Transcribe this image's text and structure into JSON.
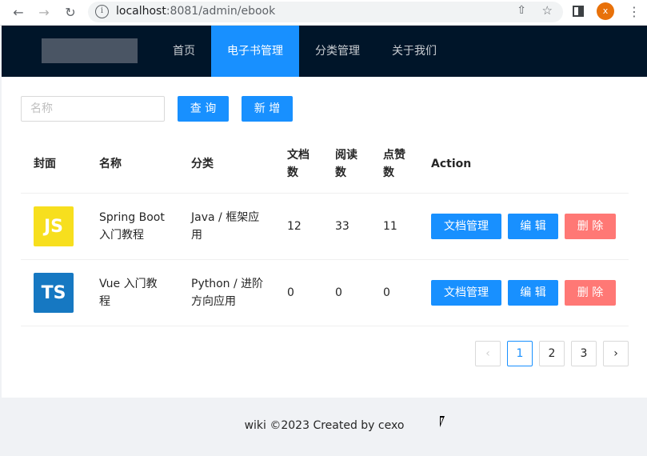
{
  "browser": {
    "url_host": "localhost",
    "url_rest": ":8081/admin/ebook",
    "profile_initial": "x"
  },
  "header": {
    "menu": [
      "首页",
      "电子书管理",
      "分类管理",
      "关于我们"
    ],
    "active_index": 1
  },
  "toolbar": {
    "search_placeholder": "名称",
    "query_label": "查 询",
    "add_label": "新 增"
  },
  "table": {
    "columns": [
      "封面",
      "名称",
      "分类",
      "文档数",
      "阅读数",
      "点赞数",
      "Action"
    ],
    "rows": [
      {
        "cover": "JS",
        "name": "Spring Boot 入门教程",
        "category": "Java / 框架应用",
        "doc_count": "12",
        "view_count": "33",
        "vote_count": "11",
        "actions": [
          "文档管理",
          "编 辑",
          "删 除"
        ]
      },
      {
        "cover": "TS",
        "name": "Vue 入门教程",
        "category": "Python / 进阶方向应用",
        "doc_count": "0",
        "view_count": "0",
        "vote_count": "0",
        "actions": [
          "文档管理",
          "编 辑",
          "删 除"
        ]
      }
    ]
  },
  "pagination": {
    "pages": [
      "1",
      "2",
      "3"
    ],
    "current": "1"
  },
  "footer": {
    "text": "wiki ©2023 Created by cexo"
  },
  "colors": {
    "header_bg": "#001529",
    "primary": "#1890ff",
    "danger": "#ff7875",
    "js_cover": "#f7df1e",
    "ts_cover": "#1678c2"
  }
}
